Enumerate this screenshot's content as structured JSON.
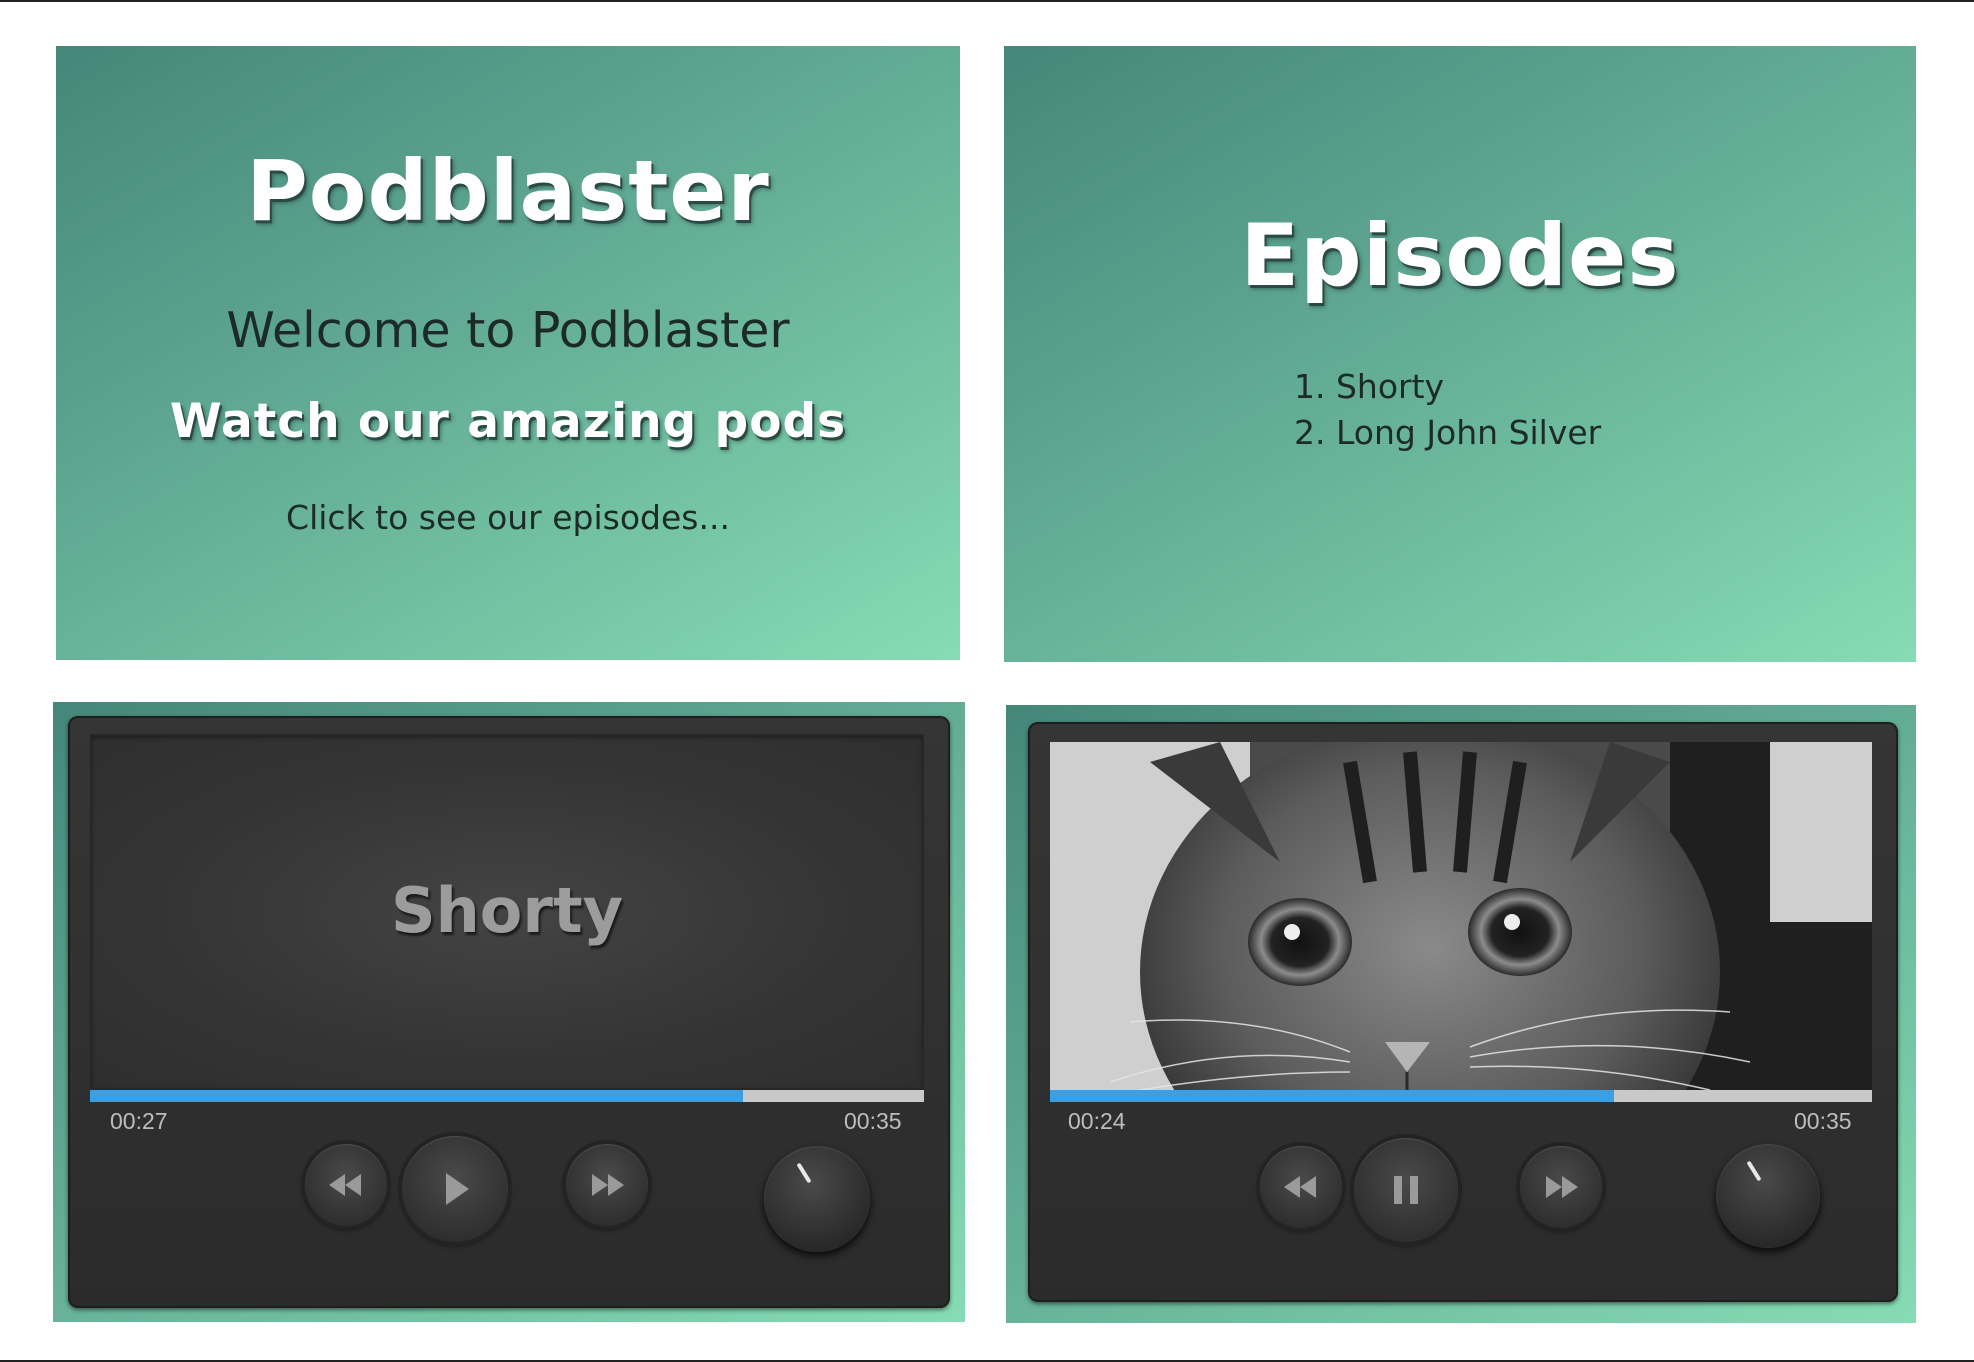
{
  "home": {
    "title": "Podblaster",
    "welcome": "Welcome to Podblaster",
    "tagline": "Watch our amazing pods",
    "link": "Click to see our episodes..."
  },
  "episodes": {
    "title": "Episodes",
    "items": [
      "1. Shorty",
      "2. Long John Silver"
    ]
  },
  "player_audio": {
    "episode_title": "Shorty",
    "current_time": "00:27",
    "duration": "00:35",
    "progress": 0.783,
    "state": "paused",
    "buttons": [
      "rewind-icon",
      "play-icon",
      "fast-forward-icon"
    ]
  },
  "player_video": {
    "current_time": "00:24",
    "duration": "00:35",
    "progress": 0.686,
    "state": "playing",
    "buttons": [
      "rewind-icon",
      "pause-icon",
      "fast-forward-icon"
    ]
  },
  "colors": {
    "panel_start": "#44877a",
    "panel_end": "#86dcb4",
    "progress_fill": "#3aa0e6",
    "player_body": "#303030"
  }
}
